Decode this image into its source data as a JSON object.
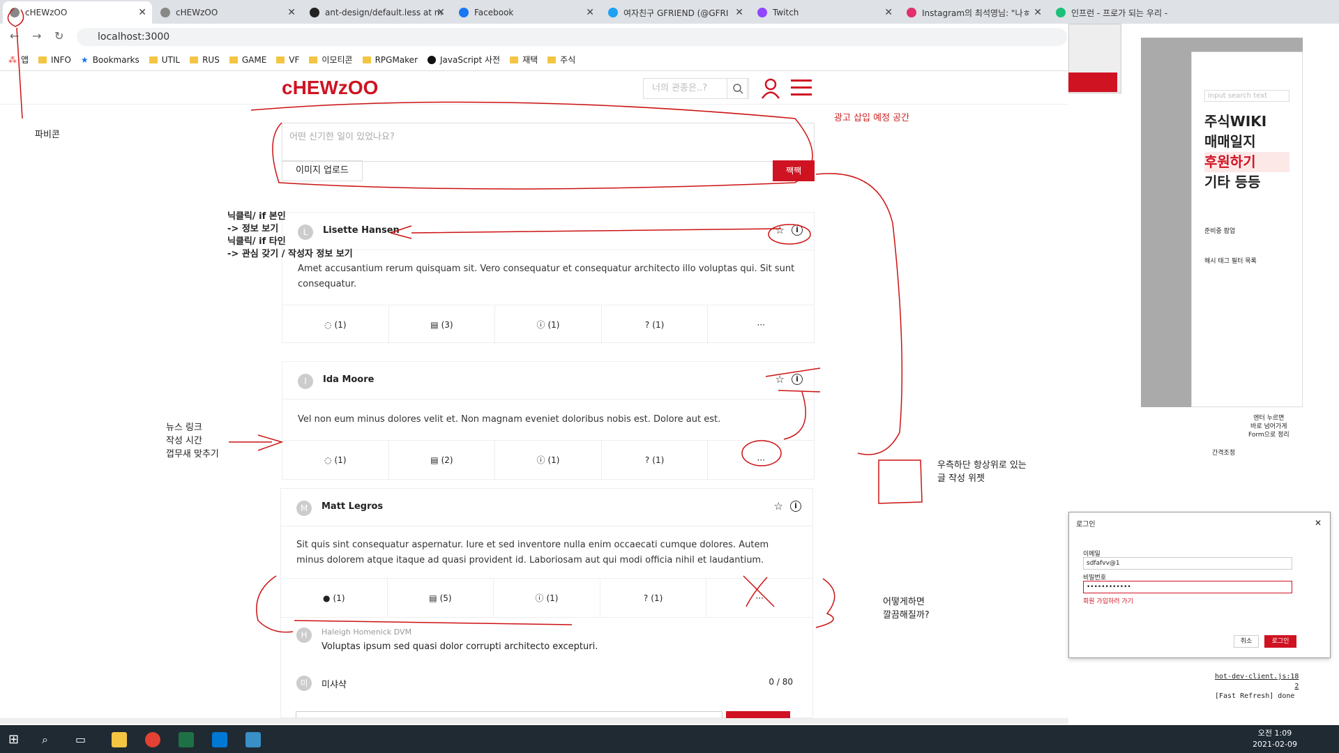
{
  "browser": {
    "tabs": [
      {
        "title": "cHEWzOO",
        "active": true
      },
      {
        "title": "cHEWzOO"
      },
      {
        "title": "ant-design/default.less at m"
      },
      {
        "title": "Facebook"
      },
      {
        "title": "여자친구 GFRIEND (@GFRI"
      },
      {
        "title": "Twitch"
      },
      {
        "title": "Instagram의 최석영님: \"나ㅎ"
      },
      {
        "title": "인프런 - 프로가 되는 우리 -"
      }
    ],
    "url": "localhost:3000",
    "bookmarks": [
      "앱",
      "INFO",
      "Bookmarks",
      "UTIL",
      "RUS",
      "GAME",
      "VF",
      "이모티콘",
      "RPGMaker",
      "JavaScript 사전",
      "재택",
      "주식"
    ]
  },
  "site": {
    "logo": "cHEWzOO",
    "search_placeholder": "너의 관종은..?",
    "ad_text": "광고 삽입 예정 공간",
    "composer": {
      "placeholder": "어떤 신기한 일이 있었나요?",
      "upload_label": "이미지 업로드",
      "submit_label": "짹짹"
    },
    "posts": [
      {
        "avatar": "L",
        "author": "Lisette Hansen",
        "text": "Amet accusantium rerum quisquam sit. Vero consequatur et consequatur architecto illo voluptas qui. Sit sunt consequatur.",
        "actions": [
          "(1)",
          "(3)",
          "(1)",
          "(1)",
          "···"
        ]
      },
      {
        "avatar": "I",
        "author": "Ida Moore",
        "text": "Vel non eum minus dolores velit et. Non magnam eveniet doloribus nobis est. Dolore aut est.",
        "actions": [
          "(1)",
          "(2)",
          "(1)",
          "(1)",
          "···"
        ]
      },
      {
        "avatar": "M",
        "author": "Matt Legros",
        "text": "Sit quis sint consequatur aspernatur. Iure et sed inventore nulla enim occaecati cumque dolores. Autem minus dolorem atque itaque ad quasi provident id. Laboriosam aut qui modi officia nihil et laudantium.",
        "actions": [
          "(1)",
          "(5)",
          "(1)",
          "(1)",
          "···"
        ]
      }
    ],
    "comment": {
      "avatar": "H",
      "author": "Haleigh Homenick DVM",
      "text": "Voluptas ipsum sed quasi dolor corrupti architecto excepturi."
    },
    "reply": {
      "avatar": "미",
      "author": "미샤샥",
      "counter": "0 / 80"
    }
  },
  "annotations": {
    "favicon": "파비콘",
    "nick_click": [
      "닉클릭/ if 본인",
      "-> 정보 보기",
      "닉클릭/ if 타인",
      "-> 관심 갖기 / 작성자 정보 보기"
    ],
    "news_link": [
      "뉴스 링크",
      "작성 시간",
      "껍무새 맞추기"
    ],
    "widget": [
      "우측하단 항상위로 있는",
      "글 작성 위젯"
    ],
    "clean": [
      "어떻게하면",
      "깔끔해질까?"
    ],
    "enter": [
      "엔터 누르면",
      "바로 넘어가게",
      "Form으로 정리"
    ],
    "spacing": "간격조정"
  },
  "side_menu": {
    "items": [
      "주식WIKI",
      "매매일지",
      "후원하기",
      "기타 등등"
    ],
    "sub": [
      "준비중 팝업",
      "해시 태그 필터 목록"
    ],
    "search_placeholder": "input search text"
  },
  "login_dialog": {
    "title": "로그인",
    "email_label": "이메일",
    "email_value": "sdfafvv@1",
    "password_label": "비밀번호",
    "password_value": "••••••••••••",
    "signup_link": "회원 가입하러 가기",
    "cancel": "취소",
    "login": "로그인"
  },
  "devtools": {
    "lines": [
      "hot-dev-client.js:18",
      "2",
      "[Fast Refresh] done"
    ]
  },
  "taskbar": {
    "time": "오전 1:09",
    "date": "2021-02-09"
  }
}
